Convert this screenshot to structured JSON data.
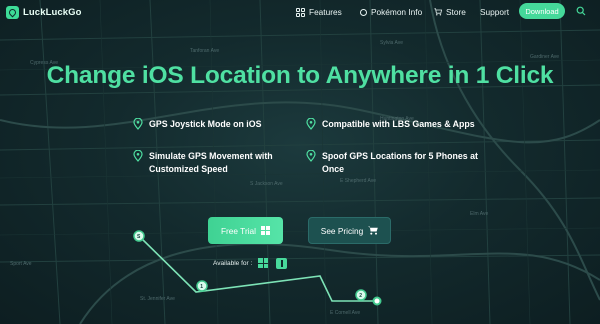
{
  "nav": {
    "logo_text": "LuckLuckGo",
    "features": "Features",
    "pokemon": "Pokémon Info",
    "store": "Store",
    "support": "Support",
    "download": "Download"
  },
  "hero": {
    "title": "Change iOS Location to Anywhere in 1 Click",
    "features": [
      "GPS Joystick Mode on iOS",
      "Compatible with LBS Games & Apps",
      "Simulate GPS Movement with Customized Speed",
      "Spoof GPS Locations for 5 Phones at Once"
    ],
    "free_trial": "Free Trial",
    "see_pricing": "See Pricing",
    "available_for": "Available for :"
  },
  "route": {
    "start_marker": "S",
    "markers": [
      "1",
      "2"
    ]
  },
  "map_labels": [
    "Tanforan Ave",
    "Sylvia Ave",
    "Gardiner Ave",
    "Cypress Ave",
    "Huntington Ave",
    "E Shepherd Ave",
    "S Jackson Ave",
    "Sport Ave",
    "E Cornell Ave",
    "St. Jennifer Ave",
    "Elm Ave"
  ],
  "colors": {
    "accent": "#4fe0a2",
    "button_green": "#45d99a",
    "background": "#132a2d",
    "route_line": "#7de3b6"
  }
}
